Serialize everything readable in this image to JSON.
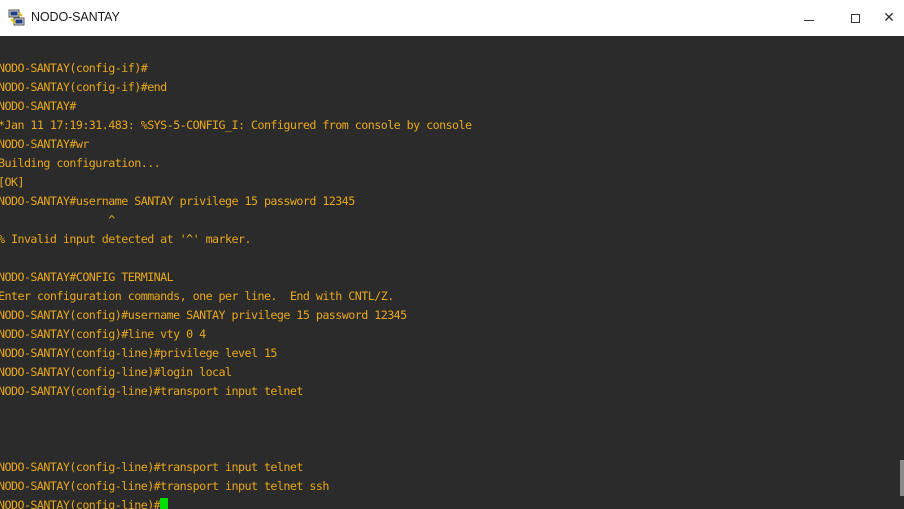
{
  "window": {
    "title": "NODO-SANTAY",
    "icon": "putty-icon",
    "controls": {
      "minimize": "minimize-icon",
      "maximize": "maximize-icon",
      "close": "close-icon",
      "close_glyph": "✕"
    }
  },
  "terminal": {
    "text_color": "#e9a81c",
    "background": "#2b2b2b",
    "cursor_color": "#00e000",
    "lines": [
      "NODO-SANTAY(config-if)#",
      "NODO-SANTAY(config-if)#end",
      "NODO-SANTAY#",
      "*Jan 11 17:19:31.483: %SYS-5-CONFIG_I: Configured from console by console",
      "NODO-SANTAY#wr",
      "Building configuration...",
      "[OK]",
      "NODO-SANTAY#username SANTAY privilege 15 password 12345",
      "                 ^",
      "% Invalid input detected at '^' marker.",
      "",
      "NODO-SANTAY#CONFIG TERMINAL",
      "Enter configuration commands, one per line.  End with CNTL/Z.",
      "NODO-SANTAY(config)#username SANTAY privilege 15 password 12345",
      "NODO-SANTAY(config)#line vty 0 4",
      "NODO-SANTAY(config-line)#privilege level 15",
      "NODO-SANTAY(config-line)#login local",
      "NODO-SANTAY(config-line)#transport input telnet",
      "",
      "",
      "",
      "NODO-SANTAY(config-line)#transport input telnet",
      "NODO-SANTAY(config-line)#transport input telnet ssh"
    ],
    "prompt": "NODO-SANTAY(config-line)#"
  }
}
